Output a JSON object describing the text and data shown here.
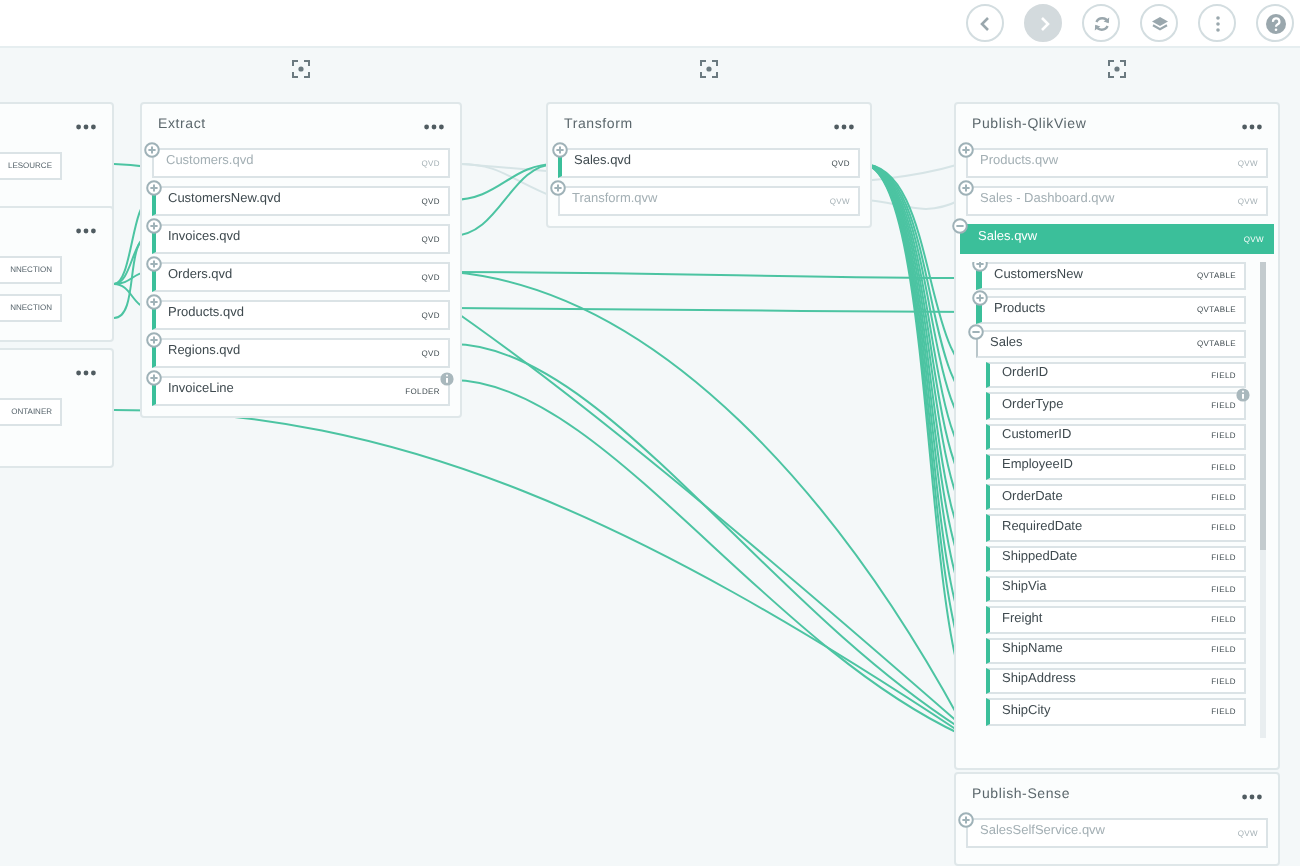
{
  "toolbar": {
    "buttons": [
      {
        "kind": "back",
        "disabled": false
      },
      {
        "kind": "forward",
        "disabled": true
      },
      {
        "kind": "refresh",
        "disabled": false
      },
      {
        "kind": "layers",
        "disabled": false
      },
      {
        "kind": "more",
        "disabled": false
      },
      {
        "kind": "help",
        "disabled": false
      }
    ]
  },
  "nodes": [
    {
      "kind": "partial",
      "items": [
        {
          "type": "LESOURCE"
        }
      ]
    },
    {
      "kind": "partial",
      "items": [
        {
          "type": "NNECTION"
        },
        {
          "type": "NNECTION"
        }
      ]
    },
    {
      "kind": "partial",
      "items": [
        {
          "type": "ONTAINER"
        }
      ]
    },
    {
      "kind": "full",
      "title": "Extract",
      "items": [
        {
          "label": "Customers.qvd",
          "type": "QVD",
          "dimmed": true,
          "highlighted": false
        },
        {
          "label": "CustomersNew.qvd",
          "type": "QVD",
          "dimmed": false,
          "highlighted": true
        },
        {
          "label": "Invoices.qvd",
          "type": "QVD",
          "dimmed": false,
          "highlighted": true
        },
        {
          "label": "Orders.qvd",
          "type": "QVD",
          "dimmed": false,
          "highlighted": true
        },
        {
          "label": "Products.qvd",
          "type": "QVD",
          "dimmed": false,
          "highlighted": true
        },
        {
          "label": "Regions.qvd",
          "type": "QVD",
          "dimmed": false,
          "highlighted": true
        },
        {
          "label": "InvoiceLine",
          "type": "FOLDER",
          "dimmed": false,
          "highlighted": true,
          "info": true
        }
      ]
    },
    {
      "kind": "full",
      "title": "Transform",
      "items": [
        {
          "label": "Sales.qvd",
          "type": "QVD",
          "dimmed": false,
          "highlighted": true
        },
        {
          "label": "Transform.qvw",
          "type": "QVW",
          "dimmed": true,
          "highlighted": false
        }
      ]
    },
    {
      "kind": "full",
      "title": "Publish-QlikView",
      "items": [
        {
          "label": "Products.qvw",
          "type": "QVW",
          "dimmed": true,
          "highlighted": false
        },
        {
          "label": "Sales - Dashboard.qvw",
          "type": "QVW",
          "dimmed": true,
          "highlighted": false
        },
        {
          "label": "Sales.qvw",
          "type": "QVW",
          "selected": true,
          "expanded": true,
          "children": [
            {
              "label": "CustomersNew",
              "type": "QVTABLE",
              "highlighted": true,
              "expanded": false
            },
            {
              "label": "Products",
              "type": "QVTABLE",
              "highlighted": true,
              "expanded": false
            },
            {
              "label": "Sales",
              "type": "QVTABLE",
              "highlighted": false,
              "expanded": true,
              "children": [
                {
                  "label": "OrderID",
                  "type": "FIELD"
                },
                {
                  "label": "OrderType",
                  "type": "FIELD",
                  "info": true
                },
                {
                  "label": "CustomerID",
                  "type": "FIELD"
                },
                {
                  "label": "EmployeeID",
                  "type": "FIELD"
                },
                {
                  "label": "OrderDate",
                  "type": "FIELD"
                },
                {
                  "label": "RequiredDate",
                  "type": "FIELD"
                },
                {
                  "label": "ShippedDate",
                  "type": "FIELD"
                },
                {
                  "label": "ShipVia",
                  "type": "FIELD"
                },
                {
                  "label": "Freight",
                  "type": "FIELD"
                },
                {
                  "label": "ShipName",
                  "type": "FIELD"
                },
                {
                  "label": "ShipAddress",
                  "type": "FIELD"
                },
                {
                  "label": "ShipCity",
                  "type": "FIELD"
                }
              ]
            }
          ]
        }
      ]
    },
    {
      "kind": "full",
      "title": "Publish-Sense",
      "items": [
        {
          "label": "SalesSelfService.qvw",
          "type": "QVW",
          "dimmed": true,
          "highlighted": false
        }
      ]
    }
  ]
}
